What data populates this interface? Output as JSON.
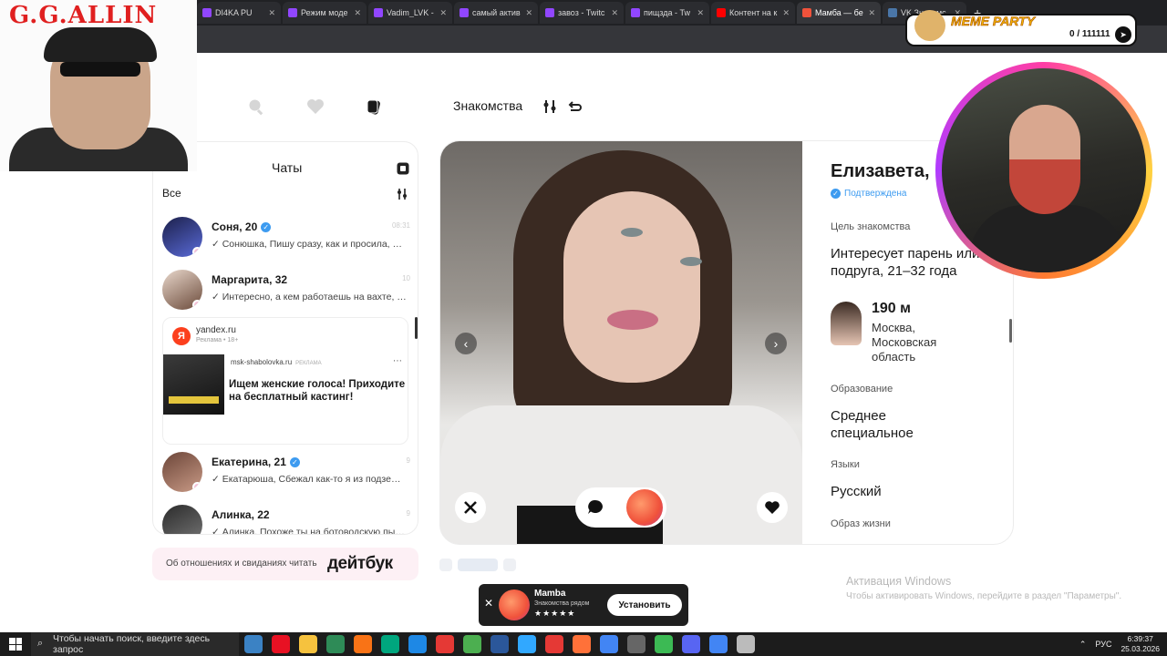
{
  "browser": {
    "tabs": [
      {
        "label": "DI4KA PU",
        "color": "#9146ff",
        "active": false
      },
      {
        "label": "Режим моде",
        "color": "#9146ff",
        "active": false
      },
      {
        "label": "Vadim_LVK -",
        "color": "#9146ff",
        "active": false
      },
      {
        "label": "самый актив",
        "color": "#9146ff",
        "active": false
      },
      {
        "label": "завоз - Twitc",
        "color": "#9146ff",
        "active": false
      },
      {
        "label": "пищзда - Tw",
        "color": "#9146ff",
        "active": false
      },
      {
        "label": "Контент на к",
        "color": "#ff0000",
        "active": false
      },
      {
        "label": "Мамба — бе",
        "color": "#f0523b",
        "active": true
      },
      {
        "label": "VK Знакомс",
        "color": "#4a76a8",
        "active": false
      }
    ],
    "new_tab": "+"
  },
  "nav": {
    "title": "Знакомства"
  },
  "chats": {
    "title": "Чаты",
    "filter": "Все",
    "items": [
      {
        "name": "Соня, 20",
        "verified": true,
        "message": "Сонюшка, Пишу сразу, как и просила, sp...",
        "time": "08:31",
        "avatar": [
          "#1b1f4a",
          "#5a6bd8"
        ]
      },
      {
        "name": "Маргарита, 32",
        "verified": false,
        "message": "Интересно, а кем работаешь на вахте, есл...",
        "time": "10",
        "avatar": [
          "#e9d8cc",
          "#6b4a3a"
        ]
      },
      {
        "name": "Екатерина, 21",
        "verified": true,
        "message": "Екатарюша, Сбежал как-то я из подземной ...",
        "time": "9",
        "avatar": [
          "#6b4538",
          "#c99a86"
        ]
      },
      {
        "name": "Алинка, 22",
        "verified": false,
        "message": "Алинка, Похоже ты на ботоводскую пылинк...",
        "time": "9",
        "avatar": [
          "#2a2a2a",
          "#777"
        ]
      }
    ],
    "ad": {
      "logo": "Я",
      "domain": "yandex.ru",
      "sub": "Реклама • 18+",
      "source": "msk-shabolovka.ru",
      "source_tag": "РЕКЛАМА",
      "title": "Ищем женские голоса! Приходите на бесплатный кастинг!"
    }
  },
  "dating_banner": {
    "text": "Об отношениях и свиданиях читать",
    "logo": "дейтбук"
  },
  "profile": {
    "name": "Елизавета,",
    "verified_label": "Подтверждена",
    "goal_label": "Цель знакомства",
    "goal_value": "Интересует парень или подруга, 21–32 года",
    "distance": "190 м",
    "location": "Москва, Московская область",
    "education_label": "Образование",
    "education_value": "Среднее специальное",
    "languages_label": "Языки",
    "languages_value": "Русский",
    "lifestyle_label": "Образ жизни"
  },
  "app_banner": {
    "name": "Mamba",
    "subtitle": "Знакомства рядом",
    "stars": "★★★★★",
    "install": "Установить",
    "close": "✕"
  },
  "windows_activation": {
    "title": "Активация Windows",
    "text": "Чтобы активировать Windows, перейдите в раздел \"Параметры\"."
  },
  "overlays": {
    "gg_title": "G.G.ALLIN",
    "meme_label": "MEME PARTY",
    "meme_count": "0 / 111111"
  },
  "taskbar": {
    "search_placeholder": "Чтобы начать поиск, введите здесь запрос",
    "lang": "РУС",
    "time": "6:39:37",
    "date": "25.03.2026",
    "apps": [
      "#3b82c4",
      "#e81123",
      "#f6c23e",
      "#2e8b57",
      "#f97316",
      "#00a67e",
      "#1e88e5",
      "#e53935",
      "#4caf50",
      "#2b579a",
      "#31a8ff",
      "#e53935",
      "#ff7139",
      "#4285f4",
      "#666",
      "#3cba54",
      "#5865f2",
      "#4285f4",
      "#bbb"
    ]
  }
}
